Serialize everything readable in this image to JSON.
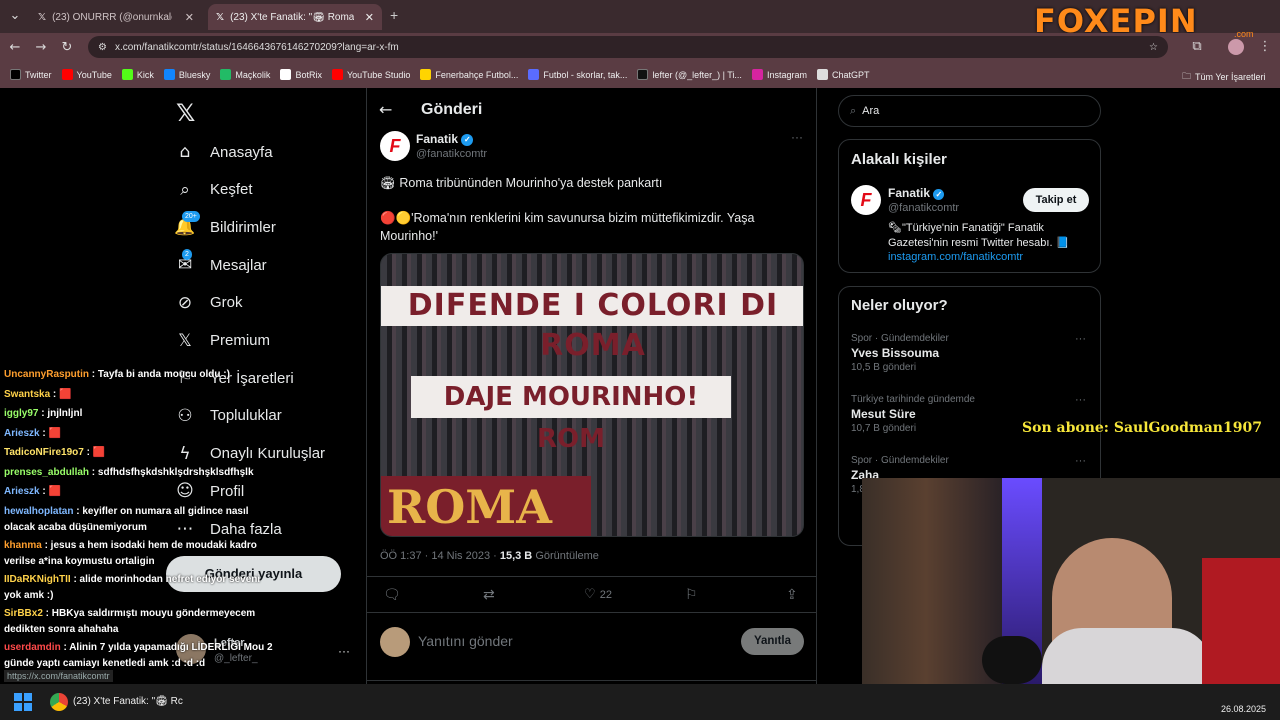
{
  "browser": {
    "tabs": [
      {
        "label": "(23) ONURRR (@onurnkalexyed",
        "active": false
      },
      {
        "label": "(23) X'te Fanatik: \"🏟 Roma tribü",
        "active": true
      }
    ],
    "new_tab_symbol": "+",
    "url": "x.com/fanatikcomtr/status/1646643676146270209?lang=ar-x-fm",
    "bookmarks": [
      "Twitter",
      "YouTube",
      "Kick",
      "Bluesky",
      "Maçkolik",
      "BotRix",
      "YouTube Studio",
      "Fenerbahçe Futbol...",
      "Futbol - skorlar, tak...",
      "lefter (@_lefter_) | Ti...",
      "Instagram",
      "ChatGPT"
    ],
    "all_bookmarks": "Tüm Yer İşaretleri"
  },
  "overlay": {
    "brand": "FOXEPIN",
    "brand_sub": ".com",
    "last_sub": "Son abone: SaulGoodman1907"
  },
  "sidebar": {
    "items": [
      {
        "label": "Anasayfa",
        "icon": "home-icon"
      },
      {
        "label": "Keşfet",
        "icon": "search-icon"
      },
      {
        "label": "Bildirimler",
        "icon": "bell-icon",
        "badge": "20+"
      },
      {
        "label": "Mesajlar",
        "icon": "mail-icon",
        "badge": "2"
      },
      {
        "label": "Grok",
        "icon": "grok-icon"
      },
      {
        "label": "Premium",
        "icon": "x-icon"
      },
      {
        "label": "Yer İşaretleri",
        "icon": "bookmark-icon"
      },
      {
        "label": "Topluluklar",
        "icon": "people-icon"
      },
      {
        "label": "Onaylı Kuruluşlar",
        "icon": "lightning-icon"
      },
      {
        "label": "Profil",
        "icon": "person-icon"
      },
      {
        "label": "Daha fazla",
        "icon": "more-icon"
      }
    ],
    "post_button": "Gönderi yayınla",
    "account_name": "Lefter",
    "account_handle": "@_lefter_"
  },
  "post": {
    "header": "Gönderi",
    "author": "Fanatik",
    "handle": "@fanatikcomtr",
    "text1": "🏟 Roma tribününden Mourinho'ya destek pankartı",
    "text2": "🔴🟡'Roma'nın renklerini kim savunursa bizim müttefikimizdir. Yaşa Mourinho!'",
    "banner1": "DIFENDE I COLORI DI ROMA",
    "banner2": "DAJE MOURINHO! ROM",
    "banner3": "ROMA",
    "time": "ÖÖ 1:37 · 14 Nis 2023 · ",
    "views": "15,3 B",
    "views_label": " Görüntüleme",
    "likes": "22",
    "reply_placeholder": "Yanıtını gönder",
    "reply_button": "Yanıtla"
  },
  "right": {
    "search_placeholder": "Ara",
    "related_title": "Alakalı kişiler",
    "related_name": "Fanatik",
    "related_handle": "@fanatikcomtr",
    "related_bio": "🗞\"Türkiye'nin Fanatiği\" Fanatik Gazetesi'nin resmi Twitter hesabı. 📘",
    "related_link": "instagram.com/fanatikcomtr",
    "follow_button": "Takip et",
    "trends_title": "Neler oluyor?",
    "trends": [
      {
        "meta": "Spor · Gündemdekiler",
        "name": "Yves Bissouma",
        "count": "10,5 B gönderi"
      },
      {
        "meta": "Türkiye tarihinde gündemde",
        "name": "Mesut Süre",
        "count": "10,7 B gönderi"
      },
      {
        "meta": "Spor · Gündemdekiler",
        "name": "Zaha",
        "count": "1,8"
      }
    ]
  },
  "chat": [
    {
      "user": "UncannyRasputin",
      "color": "#ff9f2e",
      "msg": "Tayfa bi anda moucu oldu :)"
    },
    {
      "user": "Swantska",
      "color": "#ffd24a",
      "msg": "🟥"
    },
    {
      "user": "iggly97",
      "color": "#9aff6a",
      "msg": "jnjlnljnl"
    },
    {
      "user": "Arieszk",
      "color": "#7fb8ff",
      "msg": "🟥"
    },
    {
      "user": "TadicoNFire19o7",
      "color": "#ffe46a",
      "msg": "🟥"
    },
    {
      "user": "prenses_abdullah",
      "color": "#9aff6a",
      "msg": "sdfhdsfhşkdshklşdrshşklsdfhşlk"
    },
    {
      "user": "Arieszk",
      "color": "#7fb8ff",
      "msg": "🟥"
    },
    {
      "user": "hewalhoplatan",
      "color": "#7fb8ff",
      "msg": "keyifler on numara all gidince nasıl olacak acaba düşünemiyorum"
    },
    {
      "user": "khanma",
      "color": "#ff9f2e",
      "msg": "jesus a hem isodaki hem de moudaki kadro verilse a*ina koymustu ortaligin"
    },
    {
      "user": "IIDaRKNighTII",
      "color": "#ffd24a",
      "msg": "alide morinhodan nefret ediyor seveni yok amk :)"
    },
    {
      "user": "SirBBx2",
      "color": "#ffd24a",
      "msg": "HBKya saldırmıştı mouyu göndermeyecem dedikten sonra ahahaha"
    },
    {
      "user": "userdamdin",
      "color": "#ff4a4a",
      "msg": "Alinin 7 yılda yapamadığı LİDERLİĞİ Mou 2 günde yaptı camiayı kenetledi amk :d :d :d"
    }
  ],
  "status_url": "https://x.com/fanatikcomtr",
  "taskbar": {
    "window_title": "(23) X'te Fanatik: \"🏟 Rc",
    "date": "26.08.2025"
  }
}
